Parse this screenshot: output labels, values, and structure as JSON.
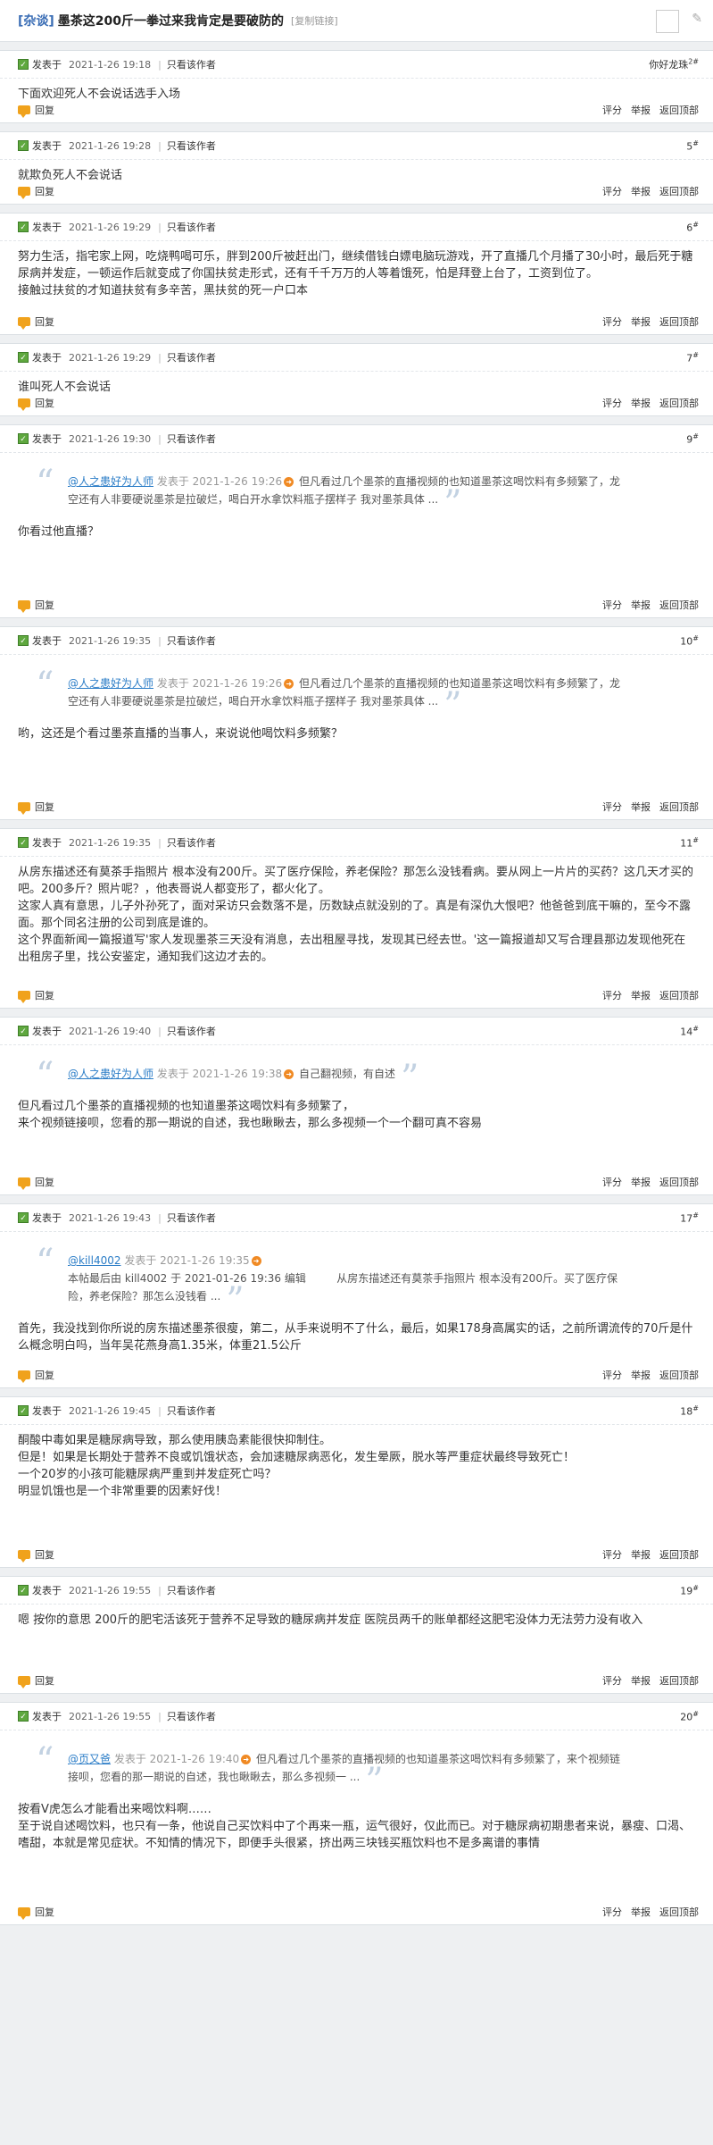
{
  "thread": {
    "category": "[杂谈]",
    "title": "墨茶这200斤一拳过来我肯定是要破防的",
    "copy_link": "[复制链接]"
  },
  "labels": {
    "posted_at": "发表于",
    "separator": "|",
    "only_author": "只看该作者",
    "reply": "回复",
    "rate": "评分",
    "report": "举报",
    "back_top": "返回顶部"
  },
  "icons": {
    "online": "online-status-icon",
    "reply": "speech-bubble-icon",
    "quote_arrow": "arrow-circle-icon"
  },
  "posts": [
    {
      "time": "2021-1-26 19:18",
      "floor": "你好龙珠",
      "floor_sup": "2#",
      "body": [
        "下面欢迎死人不会说话选手入场"
      ]
    },
    {
      "time": "2021-1-26 19:28",
      "floor": "5",
      "floor_sup": "#",
      "body": [
        "就欺负死人不会说话"
      ]
    },
    {
      "time": "2021-1-26 19:29",
      "floor": "6",
      "floor_sup": "#",
      "body": [
        "努力生活，指宅家上网，吃烧鸭喝可乐，胖到200斤被赶出门，继续借钱白嫖电脑玩游戏，开了直播几个月播了30小时，最后死于糖尿病并发症，一顿运作后就变成了你国扶贫走形式，还有千千万万的人等着饿死，怕是拜登上台了，工资到位了。",
        "    接触过扶贫的才知道扶贫有多辛苦，黑扶贫的死一户口本"
      ]
    },
    {
      "time": "2021-1-26 19:29",
      "floor": "7",
      "floor_sup": "#",
      "body": [
        "谁叫死人不会说话"
      ]
    },
    {
      "time": "2021-1-26 19:30",
      "floor": "9",
      "floor_sup": "#",
      "quote": {
        "user": "@人之患好为人师",
        "date": "发表于 2021-1-26 19:26",
        "text": "但凡看过几个墨茶的直播视频的也知道墨茶这喝饮料有多频繁了，龙空还有人非要硬说墨茶是拉破烂，喝白开水拿饮料瓶子摆样子 我对墨茶具体 ..."
      },
      "body": [
        "你看过他直播？"
      ]
    },
    {
      "time": "2021-1-26 19:35",
      "floor": "10",
      "floor_sup": "#",
      "quote": {
        "user": "@人之患好为人师",
        "date": "发表于 2021-1-26 19:26",
        "text": "但凡看过几个墨茶的直播视频的也知道墨茶这喝饮料有多频繁了，龙空还有人非要硬说墨茶是拉破烂，喝白开水拿饮料瓶子摆样子 我对墨茶具体 ..."
      },
      "body": [
        "哟，这还是个看过墨茶直播的当事人，来说说他喝饮料多频繁？"
      ]
    },
    {
      "time": "2021-1-26 19:35",
      "floor": "11",
      "floor_sup": "#",
      "body": [
        "从房东描述还有莫茶手指照片 根本没有200斤。买了医疗保险，养老保险？那怎么没钱看病。要从网上一片片的买药？这几天才买的吧。200多斤？照片呢？，他表哥说人都变形了，都火化了。",
        "这家人真有意思，儿子外孙死了，面对采访只会数落不是，历数缺点就没别的了。真是有深仇大恨吧？他爸爸到底干嘛的，至今不露面。那个同名注册的公司到底是谁的。",
        "这个界面新闻一篇报道写'家人发现墨茶三天没有消息，去出租屋寻找，发现其已经去世。'这一篇报道却又写合理县那边发现他死在出租房子里，找公安鉴定，通知我们这边才去的。"
      ]
    },
    {
      "time": "2021-1-26 19:40",
      "floor": "14",
      "floor_sup": "#",
      "quote": {
        "user": "@人之患好为人师",
        "date": "发表于 2021-1-26 19:38",
        "text": "自己翻视频，有自述"
      },
      "body": [
        "但凡看过几个墨茶的直播视频的也知道墨茶这喝饮料有多频繁了，",
        "来个视频链接呗，您看的那一期说的自述，我也瞅瞅去，那么多视频一个一个翻可真不容易"
      ]
    },
    {
      "time": "2021-1-26 19:43",
      "floor": "17",
      "floor_sup": "#",
      "quote": {
        "user": "@kill4002",
        "date": "发表于 2021-1-26 19:35",
        "edit": "本帖最后由 kill4002 于 2021-01-26 19:36 编辑",
        "text": "从房东描述还有莫茶手指照片 根本没有200斤。买了医疗保险，养老保险？那怎么没钱看 ..."
      },
      "body": [
        "首先，我没找到你所说的房东描述墨茶很瘦，第二，从手来说明不了什么，最后，如果178身高属实的话，之前所谓流传的70斤是什么概念明白吗，当年吴花燕身高1.35米，体重21.5公斤"
      ]
    },
    {
      "time": "2021-1-26 19:45",
      "floor": "18",
      "floor_sup": "#",
      "body": [
        "酮酸中毒如果是糖尿病导致，那么使用胰岛素能很快抑制住。",
        "但是！如果是长期处于营养不良或饥饿状态，会加速糖尿病恶化，发生晕厥，脱水等严重症状最终导致死亡！",
        "一个20岁的小孩可能糖尿病严重到并发症死亡吗？",
        "明显饥饿也是一个非常重要的因素好伐！"
      ]
    },
    {
      "time": "2021-1-26 19:55",
      "floor": "19",
      "floor_sup": "#",
      "body": [
        "嗯 按你的意思 200斤的肥宅活该死于营养不足导致的糖尿病并发症 医院员两千的账单都经这肥宅没体力无法劳力没有收入"
      ]
    },
    {
      "time": "2021-1-26 19:55",
      "floor": "20",
      "floor_sup": "#",
      "quote": {
        "user": "@页又爸",
        "date": "发表于 2021-1-26 19:40",
        "text": "但凡看过几个墨茶的直播视频的也知道墨茶这喝饮料有多频繁了，来个视频链接呗，您看的那一期说的自述，我也瞅瞅去，那么多视频一 ..."
      },
      "body": [
        "按看V虎怎么才能看出来喝饮料啊……",
        "至于说自述喝饮料，也只有一条，他说自己买饮料中了个再来一瓶，运气很好，仅此而已。对于糖尿病初期患者来说，暴瘦、口渴、嗜甜，本就是常见症状。不知情的情况下，即便手头很紧，挤出两三块钱买瓶饮料也不是多离谱的事情"
      ]
    }
  ]
}
